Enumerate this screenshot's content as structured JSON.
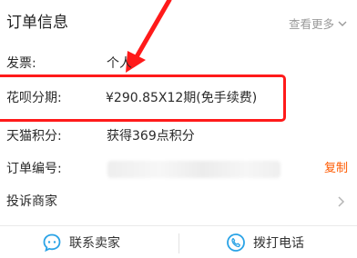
{
  "section": {
    "title": "订单信息",
    "more_label": "查看更多"
  },
  "rows": [
    {
      "label": "发票:",
      "value": "个人"
    },
    {
      "label": "花呗分期:",
      "value": "¥290.85X12期(免手续费)"
    },
    {
      "label": "天猫积分:",
      "value": "获得369点积分"
    },
    {
      "label": "订单编号:",
      "value": "",
      "action": "复制"
    },
    {
      "label": "投诉商家",
      "value": ""
    }
  ],
  "footer": {
    "contact_label": "联系卖家",
    "call_label": "拨打电话"
  },
  "colors": {
    "accent": "#ff5a00",
    "annotation": "#ff1a1a",
    "icon_blue": "#2aa3e6",
    "muted": "#9a9a9a"
  },
  "icons": {
    "more": "chevron-down-icon",
    "complain": "chevron-right-icon",
    "contact": "chat-bubble-icon",
    "call": "phone-icon"
  }
}
